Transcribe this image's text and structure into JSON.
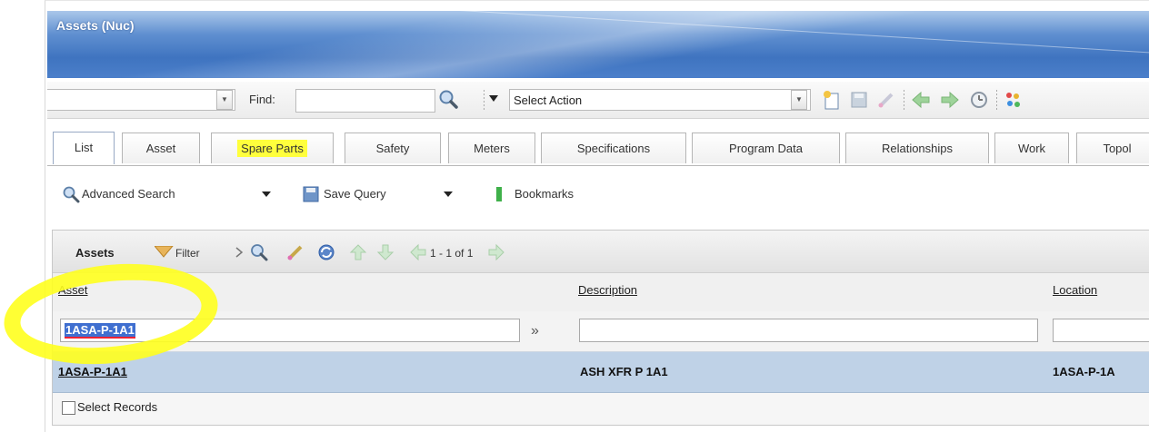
{
  "window": {
    "title": "Assets (Nuc)"
  },
  "toolbar": {
    "find_label": "Find:",
    "find_value": "",
    "action_select": "Select Action"
  },
  "tabs": [
    "List",
    "Asset",
    "Spare Parts",
    "Safety",
    "Meters",
    "Specifications",
    "Program Data",
    "Relationships",
    "Work",
    "Topol"
  ],
  "actions": {
    "advanced_search": "Advanced Search",
    "save_query": "Save Query",
    "bookmarks": "Bookmarks"
  },
  "grid": {
    "title": "Assets",
    "filter_label": "Filter",
    "count": "1 - 1 of 1",
    "columns": [
      "Asset",
      "Description",
      "Location"
    ],
    "filter_values": {
      "asset": "1ASA-P-1A1",
      "description": "",
      "location": ""
    },
    "rows": [
      {
        "asset": "1ASA-P-1A1",
        "description": "ASH XFR P 1A1",
        "location": "1ASA-P-1A"
      }
    ],
    "select_records": "Select Records"
  },
  "colors": {
    "highlight": "#ffff3c",
    "row_selected": "#bfd2e7",
    "banner": "#4b7fca"
  }
}
